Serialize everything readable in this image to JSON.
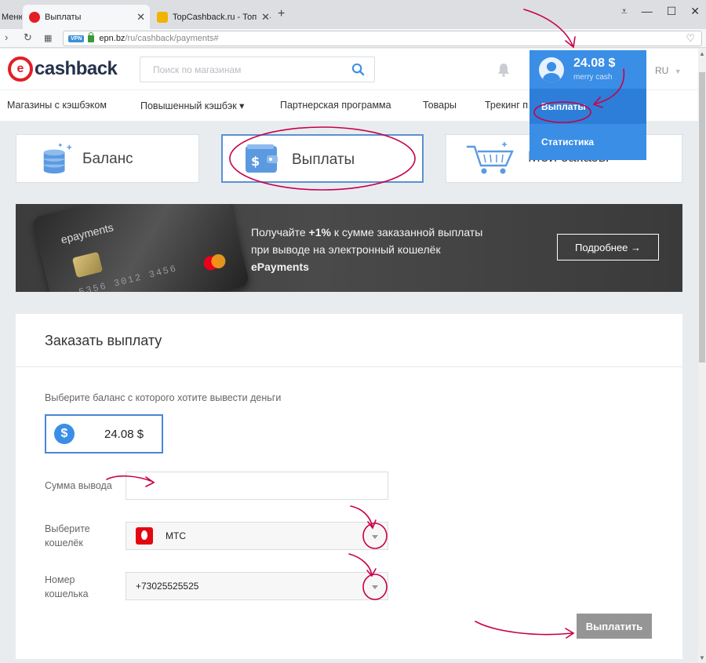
{
  "browser": {
    "tabs": [
      {
        "label": "Меню"
      },
      {
        "label": "Выплаты"
      },
      {
        "label": "TopCashback.ru - Топ лучших кэшбэк"
      }
    ],
    "url_host": "epn.bz",
    "url_path": "/ru/cashback/payments#",
    "vpn_badge": "VPN"
  },
  "header": {
    "logo_text": "cashback",
    "search_placeholder": "Поиск по магазинам",
    "lang": "RU"
  },
  "nav": {
    "items": [
      {
        "label": "Магазины с кэшбэком"
      },
      {
        "label": "Повышенный кэшбэк ▾"
      },
      {
        "label": "Партнерская программа"
      },
      {
        "label": "Товары"
      },
      {
        "label": "Трекинг п"
      }
    ]
  },
  "account": {
    "amount": "24.08 $",
    "subtitle": "merry cash",
    "menu": [
      {
        "label": "Выплаты"
      },
      {
        "label": "Статистика"
      }
    ]
  },
  "tiles": [
    {
      "label": "Баланс"
    },
    {
      "label": "Выплаты"
    },
    {
      "label": "Мои заказы"
    }
  ],
  "banner": {
    "card_brand": "epayments",
    "card_number": "5356 3012 3456",
    "line1_pre": "Получайте ",
    "line1_bold": "+1%",
    "line1_post": " к сумме заказанной выплаты",
    "line2": "при выводе на электронный кошелёк",
    "line3": "ePayments",
    "button": "Подробнее →"
  },
  "form": {
    "title": "Заказать выплату",
    "balance_question": "Выберите баланс с которого хотите вывести деньги",
    "balance_symbol": "$",
    "balance_value": "24.08 $",
    "amount_label": "Сумма вывода",
    "amount_value": "",
    "wallet_label_1": "Выберите",
    "wallet_label_2": "кошелёк",
    "wallet_value": "МТС",
    "number_label_1": "Номер",
    "number_label_2": "кошелька",
    "number_value": "+73025525525",
    "submit": "Выплатить"
  },
  "colors": {
    "accent": "#3a8ee6",
    "annotation": "#c8004a",
    "brand_red": "#e31e24"
  }
}
